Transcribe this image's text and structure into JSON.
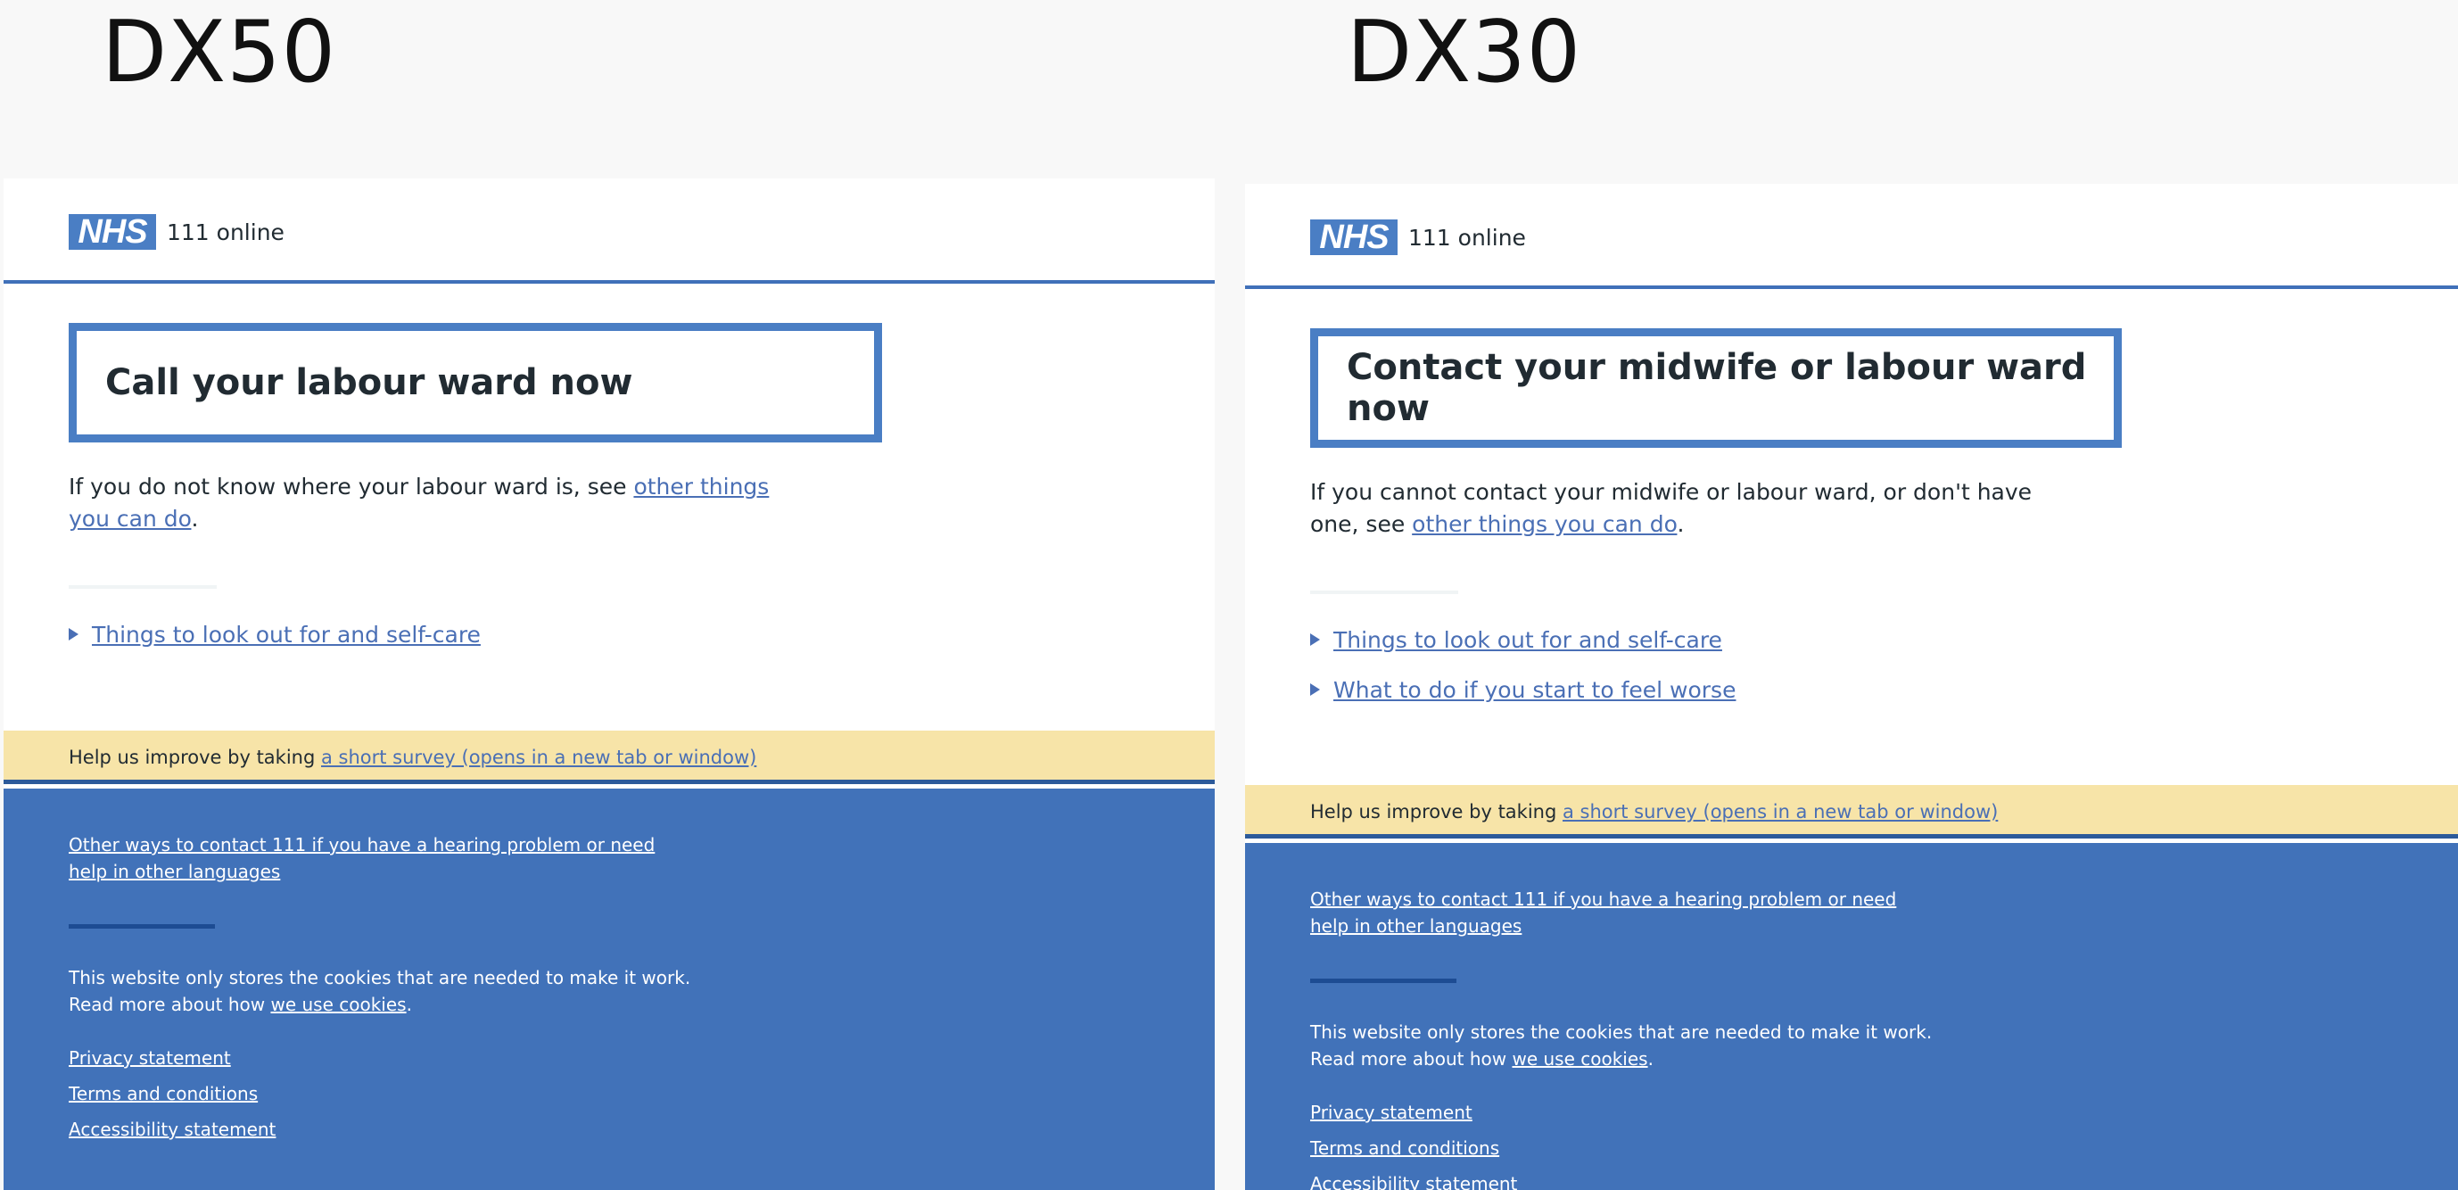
{
  "variants": [
    {
      "label": "DX50",
      "header": {
        "logo_text": "NHS",
        "service_name": "111 online"
      },
      "care_card_title": "Call your labour ward now",
      "lede": {
        "text": "If you do not know where your labour ward is, see ",
        "link": "other things you can do",
        "suffix": "."
      },
      "details": [
        {
          "label": "Things to look out for and self-care"
        }
      ],
      "survey": {
        "text": "Help us improve by taking ",
        "link": "a short survey (opens in a new tab or window)"
      },
      "footer": {
        "contact_link": "Other ways to contact 111 if you have a hearing problem or need help in other languages",
        "cookies_text": "This website only stores the cookies that are needed to make it work.",
        "cookies_read_more": "Read more about how ",
        "cookies_link": "we use cookies",
        "cookies_suffix": ".",
        "links": [
          "Privacy statement",
          "Terms and conditions",
          "Accessibility statement"
        ]
      }
    },
    {
      "label": "DX30",
      "header": {
        "logo_text": "NHS",
        "service_name": "111 online"
      },
      "care_card_title": "Contact your midwife or labour ward now",
      "lede": {
        "text": "If you cannot contact your midwife or labour ward, or don't have one, see ",
        "link": "other things you can do",
        "suffix": "."
      },
      "details": [
        {
          "label": "Things to look out for and self-care"
        },
        {
          "label": "What to do if you start to feel worse"
        }
      ],
      "survey": {
        "text": "Help us improve by taking ",
        "link": "a short survey (opens in a new tab or window)"
      },
      "footer": {
        "contact_link": "Other ways to contact 111 if you have a hearing problem or need help in other languages",
        "cookies_text": "This website only stores the cookies that are needed to make it work.",
        "cookies_read_more": "Read more about how ",
        "cookies_link": "we use cookies",
        "cookies_suffix": ".",
        "links": [
          "Privacy statement",
          "Terms and conditions",
          "Accessibility statement"
        ]
      }
    }
  ],
  "colors": {
    "nhs_blue": "#4a7ec4",
    "link_blue": "#4a6fb5",
    "footer_blue": "#4172b9",
    "survey_yellow": "#f7e4a8",
    "text": "#212b32"
  }
}
